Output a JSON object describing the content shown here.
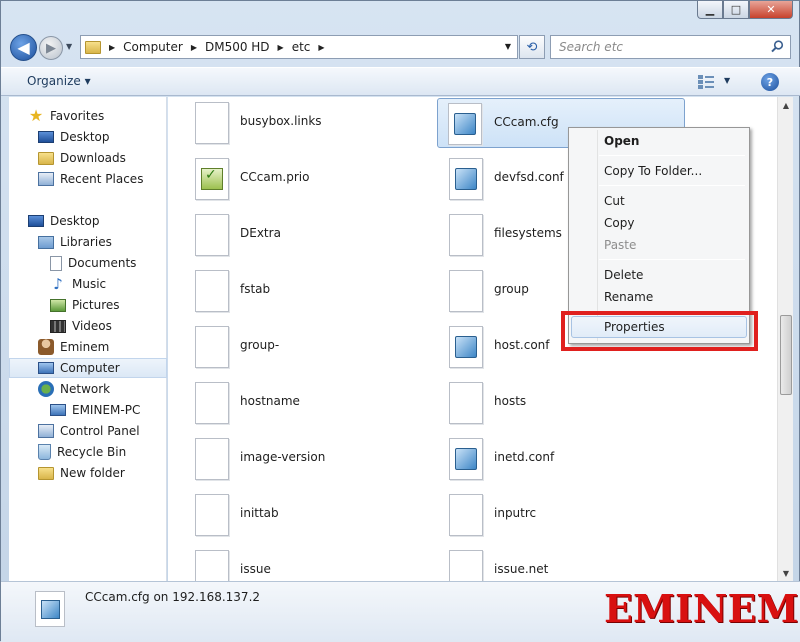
{
  "window": {
    "caption": {
      "minimize": "▁",
      "maximize": "□",
      "close": "✕"
    }
  },
  "nav": {
    "back": "◀",
    "forward": "▶",
    "breadcrumb": [
      "Computer",
      "DM500 HD",
      "etc"
    ],
    "search_placeholder": "Search etc"
  },
  "toolbar": {
    "organize": "Organize ▾",
    "view_drop": "▼",
    "help": "?"
  },
  "sidebar": {
    "items": [
      {
        "label": "Favorites",
        "icon": "star-icon"
      },
      {
        "label": "Desktop",
        "icon": "desktop-icon"
      },
      {
        "label": "Downloads",
        "icon": "folder-icon"
      },
      {
        "label": "Recent Places",
        "icon": "recent-places-icon"
      },
      {
        "label": "Desktop",
        "icon": "desktop-icon"
      },
      {
        "label": "Libraries",
        "icon": "libraries-icon"
      },
      {
        "label": "Documents",
        "icon": "documents-icon"
      },
      {
        "label": "Music",
        "icon": "music-icon"
      },
      {
        "label": "Pictures",
        "icon": "pictures-icon"
      },
      {
        "label": "Videos",
        "icon": "videos-icon"
      },
      {
        "label": "Eminem",
        "icon": "user-folder-icon"
      },
      {
        "label": "Computer",
        "icon": "computer-icon"
      },
      {
        "label": "Network",
        "icon": "network-icon"
      },
      {
        "label": "EMINEM-PC",
        "icon": "pc-icon"
      },
      {
        "label": "Control Panel",
        "icon": "control-panel-icon"
      },
      {
        "label": "Recycle Bin",
        "icon": "recycle-bin-icon"
      },
      {
        "label": "New folder",
        "icon": "folder-icon"
      }
    ]
  },
  "files": [
    {
      "name": "busybox.links",
      "type": "blank"
    },
    {
      "name": "CCcam.cfg",
      "type": "cfg"
    },
    {
      "name": "CCcam.prio",
      "type": "prio"
    },
    {
      "name": "devfsd.conf",
      "type": "cfg"
    },
    {
      "name": "DExtra",
      "type": "blank"
    },
    {
      "name": "filesystems",
      "type": "blank"
    },
    {
      "name": "fstab",
      "type": "blank"
    },
    {
      "name": "group",
      "type": "blank"
    },
    {
      "name": "group-",
      "type": "blank"
    },
    {
      "name": "host.conf",
      "type": "cfg"
    },
    {
      "name": "hostname",
      "type": "blank"
    },
    {
      "name": "hosts",
      "type": "blank"
    },
    {
      "name": "image-version",
      "type": "blank"
    },
    {
      "name": "inetd.conf",
      "type": "cfg"
    },
    {
      "name": "inittab",
      "type": "blank"
    },
    {
      "name": "inputrc",
      "type": "blank"
    },
    {
      "name": "issue",
      "type": "blank"
    },
    {
      "name": "issue.net",
      "type": "blank"
    }
  ],
  "context_menu": {
    "items": [
      "Open",
      "Copy To Folder...",
      "Cut",
      "Copy",
      "Paste",
      "Delete",
      "Rename",
      "Properties"
    ]
  },
  "scrollbar": {
    "up": "▲",
    "down": "▼"
  },
  "details": {
    "text": "CCcam.cfg on 192.168.137.2",
    "watermark": "EMINEM"
  },
  "colors": {
    "highlight_box": "#e0201e",
    "watermark": "#d81010",
    "selection": "#cde2f7"
  }
}
